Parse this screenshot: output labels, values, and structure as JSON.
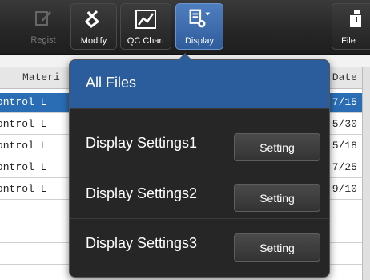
{
  "toolbar": {
    "buttons": [
      {
        "label": "Regist",
        "icon": "pencil-icon"
      },
      {
        "label": "Modify",
        "icon": "modify-icon"
      },
      {
        "label": "QC Chart",
        "icon": "line-chart-icon"
      },
      {
        "label": "Display",
        "icon": "display-settings-icon"
      },
      {
        "label": "File",
        "icon": "file-icon"
      }
    ]
  },
  "table": {
    "headers": {
      "material": "Materi",
      "date": "Date"
    },
    "rows": [
      {
        "material": "ontrol L",
        "date": "7/15"
      },
      {
        "material": "ontrol L",
        "date": "5/30"
      },
      {
        "material": "ontrol L",
        "date": "5/18"
      },
      {
        "material": "ontrol L",
        "date": "7/25"
      },
      {
        "material": "ontrol L",
        "date": "9/10"
      }
    ]
  },
  "display_menu": {
    "items": [
      {
        "label": "All Files"
      },
      {
        "label": "Display Settings1",
        "button": "Setting"
      },
      {
        "label": "Display Settings2",
        "button": "Setting"
      },
      {
        "label": "Display Settings3",
        "button": "Setting"
      }
    ]
  },
  "colors": {
    "accent": "#2b5c9c",
    "toolbar": "#262626",
    "selected_row": "#2a6db5"
  }
}
